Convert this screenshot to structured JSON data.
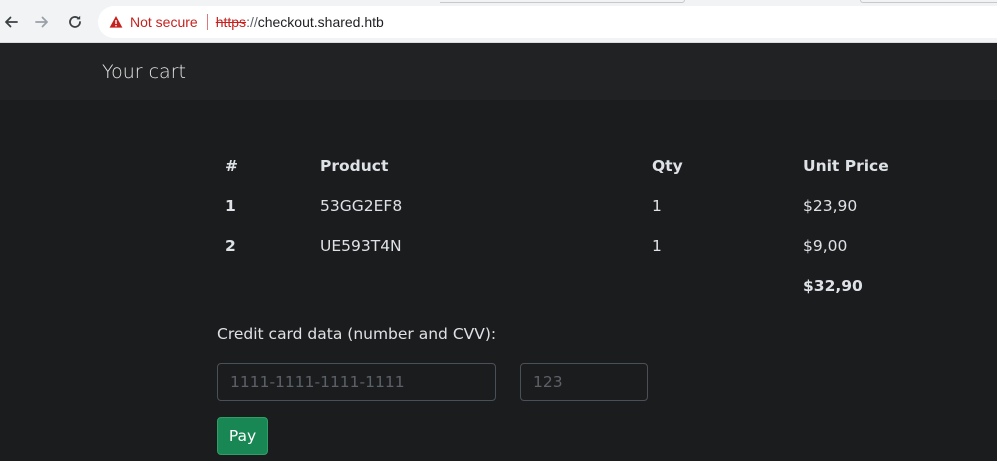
{
  "browser": {
    "security_label": "Not secure",
    "url_scheme": "https",
    "url_separator": "://",
    "url_host": "checkout.shared.htb",
    "icons": [
      "back-arrow-icon",
      "forward-arrow-icon",
      "reload-icon",
      "warning-triangle-icon"
    ],
    "colors": {
      "warning": "#c5221f"
    }
  },
  "navbar": {
    "brand": "Your cart"
  },
  "cart": {
    "headers": [
      "#",
      "Product",
      "Qty",
      "Unit Price"
    ],
    "rows": [
      {
        "index": "1",
        "product": "53GG2EF8",
        "qty": "1",
        "unit_price": "$23,90"
      },
      {
        "index": "2",
        "product": "UE593T4N",
        "qty": "1",
        "unit_price": "$9,00"
      }
    ],
    "total": "$32,90"
  },
  "payment": {
    "label": "Credit card data (number and CVV):",
    "card_number_placeholder": "1111-1111-1111-1111",
    "cvv_placeholder": "123",
    "pay_label": "Pay",
    "colors": {
      "pay_button": "#198754"
    }
  }
}
